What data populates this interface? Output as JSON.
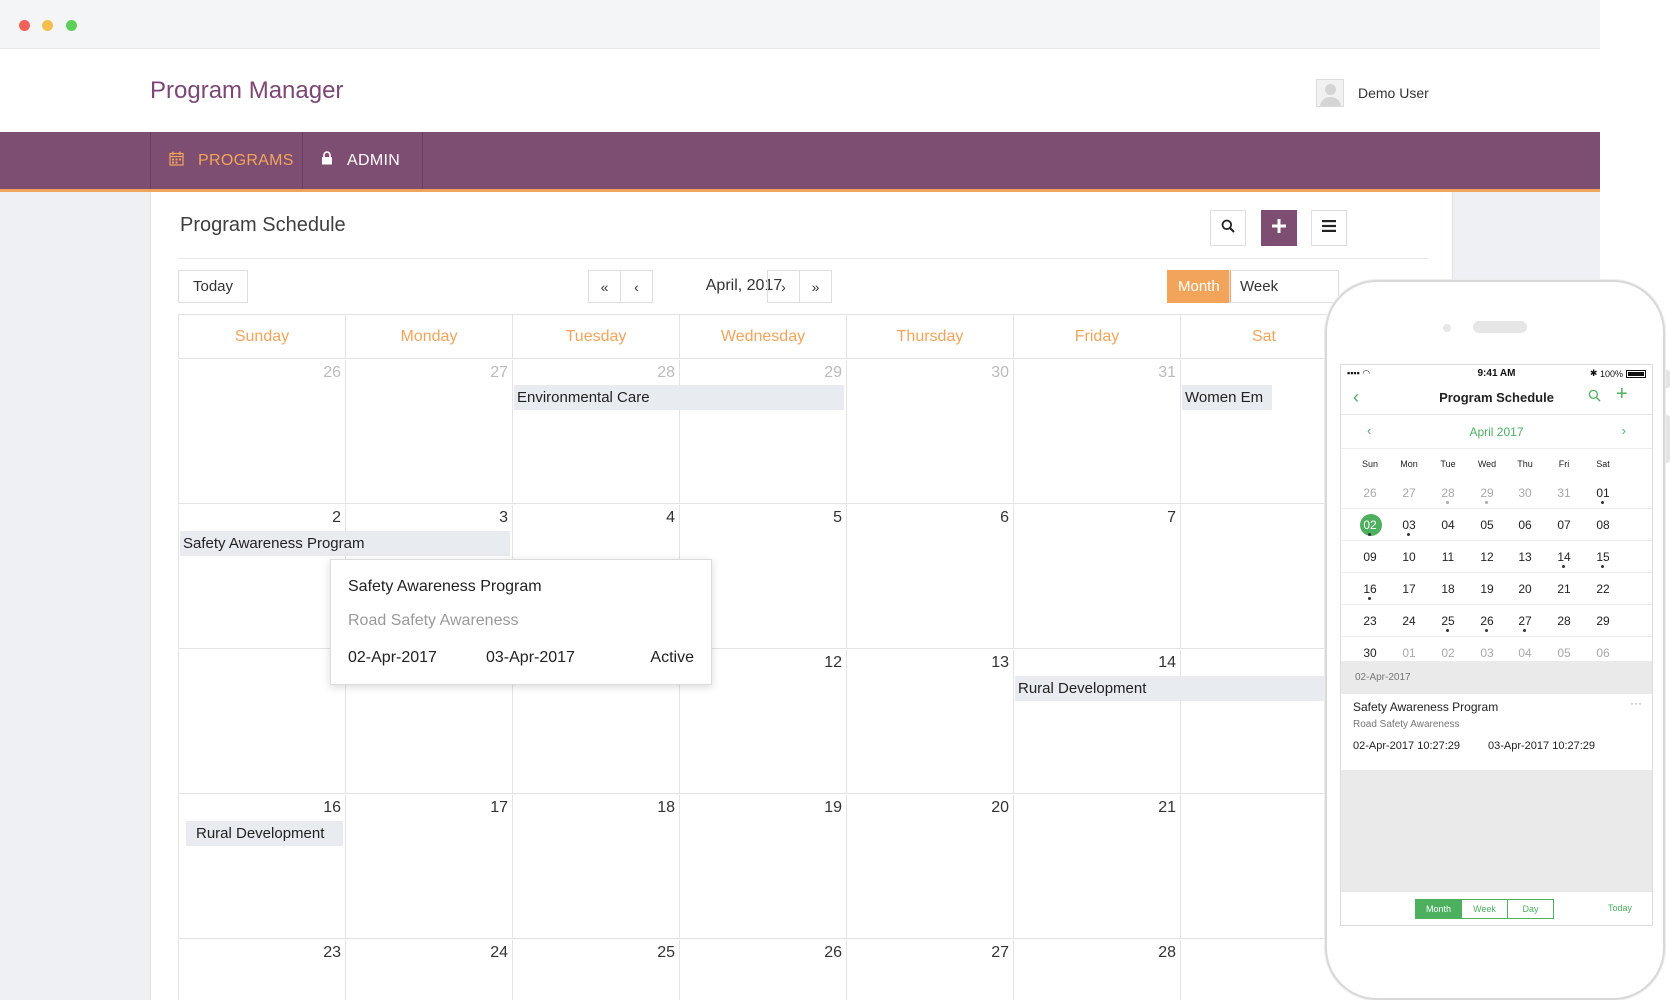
{
  "app": {
    "brand": "Program Manager",
    "user_name": "Demo User"
  },
  "nav": [
    {
      "label": "PROGRAMS",
      "icon": "calendar-icon",
      "active": true
    },
    {
      "label": "ADMIN",
      "icon": "lock-icon",
      "active": false
    }
  ],
  "page": {
    "title": "Program Schedule",
    "toolbar": {
      "search_icon": "search-icon",
      "add_icon": "plus-icon",
      "menu_icon": "hamburger-icon"
    }
  },
  "calendar": {
    "today_label": "Today",
    "month_label": "April, 2017",
    "views": [
      "Month",
      "Week"
    ],
    "active_view": "Month",
    "weekdays": [
      "Sunday",
      "Monday",
      "Tuesday",
      "Wednesday",
      "Thursday",
      "Friday",
      "Sat"
    ],
    "weeks": [
      {
        "days": [
          "26",
          "27",
          "28",
          "29",
          "30",
          "31",
          ""
        ],
        "muted": [
          true,
          true,
          true,
          true,
          true,
          true,
          false
        ]
      },
      {
        "days": [
          "2",
          "3",
          "4",
          "5",
          "6",
          "7",
          ""
        ],
        "muted": [
          false,
          false,
          false,
          false,
          false,
          false,
          false
        ]
      },
      {
        "days": [
          "",
          "",
          "",
          "12",
          "13",
          "14",
          ""
        ],
        "muted": [
          false,
          false,
          false,
          false,
          false,
          false,
          false
        ]
      },
      {
        "days": [
          "16",
          "17",
          "18",
          "19",
          "20",
          "21",
          ""
        ],
        "muted": [
          false,
          false,
          false,
          false,
          false,
          false,
          false
        ]
      },
      {
        "days": [
          "23",
          "24",
          "25",
          "26",
          "27",
          "28",
          ""
        ],
        "muted": [
          false,
          false,
          false,
          false,
          false,
          false,
          false
        ]
      }
    ],
    "events": [
      {
        "label": "Environmental Care"
      },
      {
        "label": "Women Em"
      },
      {
        "label": "Safety Awareness Program"
      },
      {
        "label": "Rural Development"
      },
      {
        "label": "Rural Development"
      }
    ],
    "popup": {
      "title": "Safety Awareness Program",
      "subtitle": "Road Safety Awareness",
      "start": "02-Apr-2017",
      "end": "03-Apr-2017",
      "status": "Active"
    }
  },
  "mobile": {
    "status": {
      "time": "9:41 AM",
      "battery": "100%"
    },
    "title": "Program Schedule",
    "month": "April 2017",
    "weekdays": [
      "Sun",
      "Mon",
      "Tue",
      "Wed",
      "Thu",
      "Fri",
      "Sat"
    ],
    "rows": [
      [
        "26",
        "27",
        "28",
        "29",
        "30",
        "31",
        "01"
      ],
      [
        "02",
        "03",
        "04",
        "05",
        "06",
        "07",
        "08"
      ],
      [
        "09",
        "10",
        "11",
        "12",
        "13",
        "14",
        "15"
      ],
      [
        "16",
        "17",
        "18",
        "19",
        "20",
        "21",
        "22"
      ],
      [
        "23",
        "24",
        "25",
        "26",
        "27",
        "28",
        "29"
      ],
      [
        "30",
        "01",
        "02",
        "03",
        "04",
        "05",
        "06"
      ]
    ],
    "selected_date": "02-Apr-2017",
    "card": {
      "title": "Safety Awareness Program",
      "subtitle": "Road Safety Awareness",
      "start": "02-Apr-2017 10:27:29",
      "end": "03-Apr-2017 10:27:29",
      "more": "···"
    },
    "tabs": [
      "Month",
      "Week",
      "Day"
    ],
    "today_label": "Today"
  }
}
